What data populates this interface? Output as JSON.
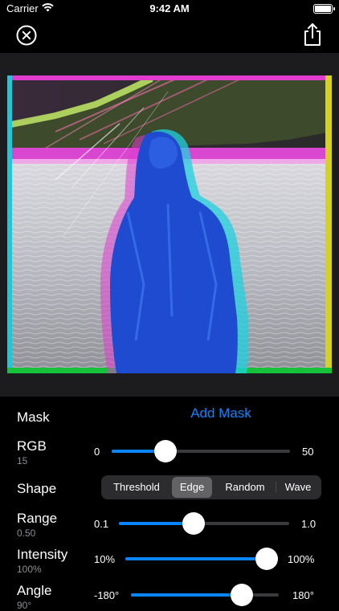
{
  "status_bar": {
    "carrier": "Carrier",
    "time": "9:42 AM"
  },
  "nav": {
    "close_icon": "close-circle-icon",
    "share_icon": "share-icon"
  },
  "photo": {
    "description_icon": "glitch-photo"
  },
  "controls": {
    "mask": {
      "label": "Mask",
      "action": "Add Mask"
    },
    "rgb": {
      "label": "RGB",
      "value": "15",
      "min": "0",
      "max": "50",
      "fraction": 0.3
    },
    "shape": {
      "label": "Shape",
      "options": [
        "Threshold",
        "Edge",
        "Random",
        "Wave"
      ],
      "selected": "Edge"
    },
    "range": {
      "label": "Range",
      "value": "0.50",
      "min": "0.1",
      "max": "1.0",
      "fraction": 0.44
    },
    "intensity": {
      "label": "Intensity",
      "value": "100%",
      "min": "10%",
      "max": "100%",
      "fraction": 1.0
    },
    "angle": {
      "label": "Angle",
      "value": "90°",
      "min": "-180°",
      "max": "180°",
      "fraction": 0.75
    }
  },
  "colors": {
    "accent": "#0a84ff",
    "panel": "#1c1c1e",
    "segment_bg": "#2c2c2e",
    "segment_selected": "#636366"
  }
}
